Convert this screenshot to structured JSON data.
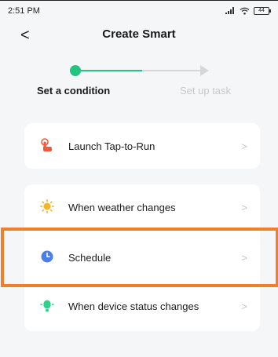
{
  "status_bar": {
    "time": "2:51 PM",
    "battery": "44"
  },
  "header": {
    "title": "Create Smart",
    "back_glyph": "<"
  },
  "stepper": {
    "steps": [
      {
        "label": "Set a condition",
        "active": true
      },
      {
        "label": "Set up task",
        "active": false
      }
    ]
  },
  "conditions": [
    {
      "label": "Launch Tap-to-Run",
      "icon": "tap-to-run-icon",
      "icon_color": "#f15a3a"
    },
    {
      "label": "When weather changes",
      "icon": "sun-icon",
      "icon_color": "#f7b51f"
    },
    {
      "label": "Schedule",
      "icon": "clock-icon",
      "icon_color": "#4a7ee8"
    },
    {
      "label": "When device status changes",
      "icon": "device-status-icon",
      "icon_color": "#31d08a"
    }
  ],
  "chevron": ">",
  "colors": {
    "accent": "#22c57f",
    "highlight": "#ee7f2d"
  }
}
